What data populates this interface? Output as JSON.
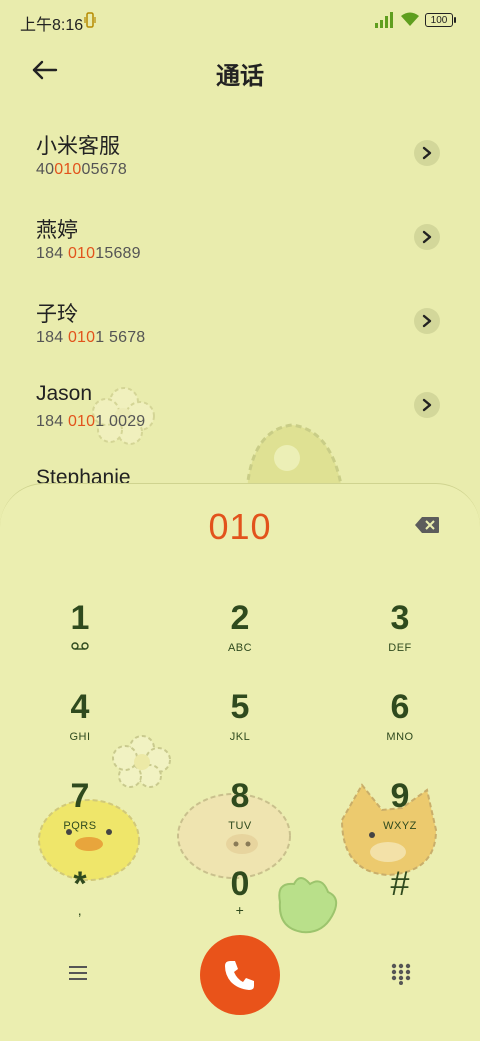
{
  "status_bar": {
    "time": "上午8:16",
    "battery": "100"
  },
  "header": {
    "title": "通话"
  },
  "contacts": [
    {
      "name": "小米客服",
      "num_pre": "40",
      "num_hl": "010",
      "num_post": "05678"
    },
    {
      "name": "燕婷",
      "num_pre": "184 ",
      "num_hl": "010",
      "num_post": "15689"
    },
    {
      "name": "子玲",
      "num_pre": "184 ",
      "num_hl": "010",
      "num_post": "1 5678"
    },
    {
      "name": "Jason",
      "num_pre": "184 ",
      "num_hl": "010",
      "num_post": "1 0029"
    },
    {
      "name": "Stephanie",
      "num_pre": "",
      "num_hl": "",
      "num_post": ""
    }
  ],
  "dialer": {
    "input": "010",
    "keys": [
      {
        "digit": "1",
        "letters": ""
      },
      {
        "digit": "2",
        "letters": "ABC"
      },
      {
        "digit": "3",
        "letters": "DEF"
      },
      {
        "digit": "4",
        "letters": "GHI"
      },
      {
        "digit": "5",
        "letters": "JKL"
      },
      {
        "digit": "6",
        "letters": "MNO"
      },
      {
        "digit": "7",
        "letters": "PQRS"
      },
      {
        "digit": "8",
        "letters": "TUV"
      },
      {
        "digit": "9",
        "letters": "WXYZ"
      },
      {
        "digit": "*",
        "letters": ","
      },
      {
        "digit": "0",
        "letters": "+"
      },
      {
        "digit": "#",
        "letters": ""
      }
    ]
  },
  "colors": {
    "background": "#e9ecad",
    "accent": "#e2531c",
    "key_text": "#2f4a1e",
    "call": "#e9531a"
  },
  "icons": [
    "back-arrow-icon",
    "chevron-right-icon",
    "backspace-icon",
    "voicemail-icon",
    "menu-icon",
    "phone-icon",
    "dialpad-icon"
  ]
}
